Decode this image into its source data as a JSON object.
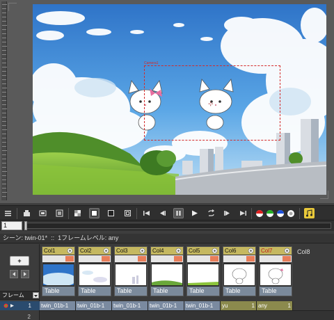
{
  "viewer": {
    "camera_label": "Camera1"
  },
  "toolbar": {
    "buttons": [
      {
        "name": "menu-icon"
      },
      {
        "name": "camera-stand-toggle-icon"
      },
      {
        "name": "preview-toggle-icon"
      },
      {
        "name": "sub-camera-preview-icon"
      },
      {
        "name": "checkerboard-bg-icon"
      },
      {
        "name": "white-bg-icon"
      },
      {
        "name": "black-bg-icon"
      },
      {
        "name": "safe-area-icon"
      },
      {
        "name": "first-frame-icon"
      },
      {
        "name": "prev-frame-icon"
      },
      {
        "name": "pause-icon"
      },
      {
        "name": "play-icon"
      },
      {
        "name": "loop-icon"
      },
      {
        "name": "next-frame-icon"
      },
      {
        "name": "last-frame-icon"
      },
      {
        "name": "red-channel-icon"
      },
      {
        "name": "green-channel-icon"
      },
      {
        "name": "blue-channel-icon"
      },
      {
        "name": "alpha-channel-icon"
      },
      {
        "name": "sound-icon"
      }
    ]
  },
  "frame_field": {
    "value": "1"
  },
  "xsheet": {
    "title": "シーン: twin-01*  ::  1フレームレベル: any",
    "new_level_label": "+",
    "frame_header": "フレーム",
    "row1": "1",
    "row2": "2",
    "columns": [
      {
        "name": "Col1",
        "type": "Table",
        "cell": "twin_01b-1",
        "red": false
      },
      {
        "name": "Col2",
        "type": "Table",
        "cell": "twin_01b-1",
        "red": false
      },
      {
        "name": "Col3",
        "type": "Table",
        "cell": "twin_01b-1",
        "red": false
      },
      {
        "name": "Col4",
        "type": "Table",
        "cell": "twin_01b-1",
        "red": false
      },
      {
        "name": "Col5",
        "type": "Table",
        "cell": "twin_01b-1",
        "red": false
      },
      {
        "name": "Col6",
        "type": "Table",
        "cell": "yu",
        "cell_frame": "1",
        "red": false
      },
      {
        "name": "Col7",
        "type": "Table",
        "cell": "any",
        "cell_frame": "1",
        "red": true
      }
    ],
    "col8": "Col8"
  },
  "colors": {
    "column_header": "#c5b860",
    "table_cell": "#7a8aa0",
    "level_cell": "#8b8a4d",
    "current_row": "#2a4b6e",
    "camera_box": "#d42a2a"
  }
}
